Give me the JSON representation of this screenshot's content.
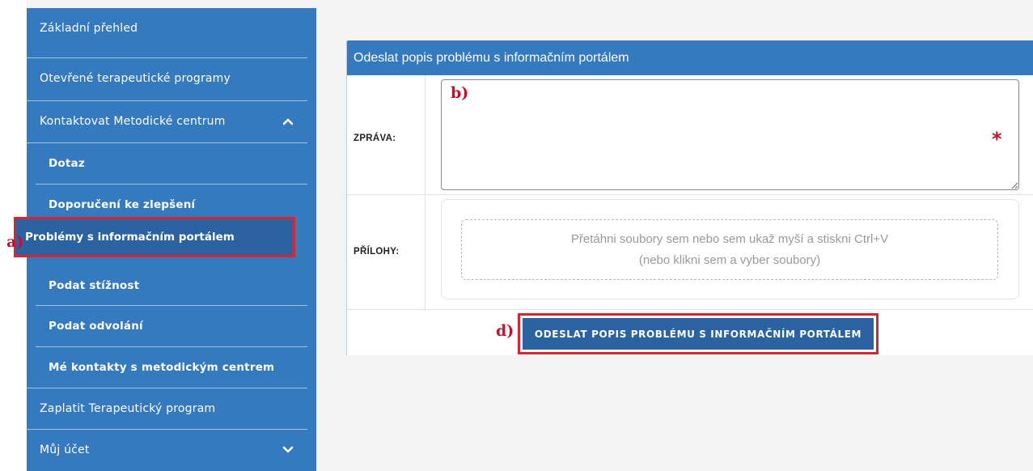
{
  "sidebar": {
    "items": [
      {
        "label": "Základní přehled"
      },
      {
        "label": "Otevřené terapeutické programy"
      },
      {
        "label": "Kontaktovat Metodické centrum"
      },
      {
        "label": "Dotaz"
      },
      {
        "label": "Doporučení ke zlepšení"
      },
      {
        "label": "Problémy s informačním portálem"
      },
      {
        "label": "Podat stížnost"
      },
      {
        "label": "Podat odvolání"
      },
      {
        "label": "Mé kontakty s metodickým centrem"
      },
      {
        "label": "Zaplatit Terapeutický program"
      },
      {
        "label": "Můj účet"
      }
    ],
    "expanded_icon": "chevron-up-icon",
    "collapsed_icon": "chevron-down-icon"
  },
  "annotations": {
    "a": "a)",
    "b": "b)",
    "d": "d)"
  },
  "form": {
    "title": "Odeslat popis problému s informačním portálem",
    "message_label": "ZPRÁVA:",
    "message_value": "",
    "required_marker": "*",
    "attachments_label": "PŘÍLOHY:",
    "dropzone_line1": "Přetáhni soubory sem nebo sem ukaž myší a stiskni Ctrl+V",
    "dropzone_line2": "(nebo klikni sem a vyber soubory)",
    "submit_label": "ODESLAT POPIS PROBLÉMU S INFORMAČNÍM PORTÁLEM"
  },
  "colors": {
    "accent": "#3579bf",
    "active": "#2b62a1",
    "highlight": "#d7262f"
  }
}
